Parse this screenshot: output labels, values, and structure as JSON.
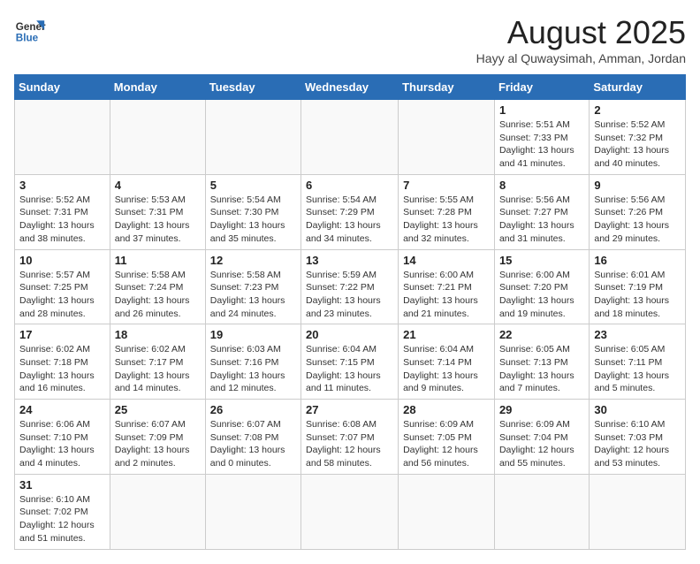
{
  "logo": {
    "line1": "General",
    "line2": "Blue"
  },
  "title": "August 2025",
  "subtitle": "Hayy al Quwaysimah, Amman, Jordan",
  "weekdays": [
    "Sunday",
    "Monday",
    "Tuesday",
    "Wednesday",
    "Thursday",
    "Friday",
    "Saturday"
  ],
  "weeks": [
    [
      {
        "day": "",
        "info": ""
      },
      {
        "day": "",
        "info": ""
      },
      {
        "day": "",
        "info": ""
      },
      {
        "day": "",
        "info": ""
      },
      {
        "day": "",
        "info": ""
      },
      {
        "day": "1",
        "info": "Sunrise: 5:51 AM\nSunset: 7:33 PM\nDaylight: 13 hours\nand 41 minutes."
      },
      {
        "day": "2",
        "info": "Sunrise: 5:52 AM\nSunset: 7:32 PM\nDaylight: 13 hours\nand 40 minutes."
      }
    ],
    [
      {
        "day": "3",
        "info": "Sunrise: 5:52 AM\nSunset: 7:31 PM\nDaylight: 13 hours\nand 38 minutes."
      },
      {
        "day": "4",
        "info": "Sunrise: 5:53 AM\nSunset: 7:31 PM\nDaylight: 13 hours\nand 37 minutes."
      },
      {
        "day": "5",
        "info": "Sunrise: 5:54 AM\nSunset: 7:30 PM\nDaylight: 13 hours\nand 35 minutes."
      },
      {
        "day": "6",
        "info": "Sunrise: 5:54 AM\nSunset: 7:29 PM\nDaylight: 13 hours\nand 34 minutes."
      },
      {
        "day": "7",
        "info": "Sunrise: 5:55 AM\nSunset: 7:28 PM\nDaylight: 13 hours\nand 32 minutes."
      },
      {
        "day": "8",
        "info": "Sunrise: 5:56 AM\nSunset: 7:27 PM\nDaylight: 13 hours\nand 31 minutes."
      },
      {
        "day": "9",
        "info": "Sunrise: 5:56 AM\nSunset: 7:26 PM\nDaylight: 13 hours\nand 29 minutes."
      }
    ],
    [
      {
        "day": "10",
        "info": "Sunrise: 5:57 AM\nSunset: 7:25 PM\nDaylight: 13 hours\nand 28 minutes."
      },
      {
        "day": "11",
        "info": "Sunrise: 5:58 AM\nSunset: 7:24 PM\nDaylight: 13 hours\nand 26 minutes."
      },
      {
        "day": "12",
        "info": "Sunrise: 5:58 AM\nSunset: 7:23 PM\nDaylight: 13 hours\nand 24 minutes."
      },
      {
        "day": "13",
        "info": "Sunrise: 5:59 AM\nSunset: 7:22 PM\nDaylight: 13 hours\nand 23 minutes."
      },
      {
        "day": "14",
        "info": "Sunrise: 6:00 AM\nSunset: 7:21 PM\nDaylight: 13 hours\nand 21 minutes."
      },
      {
        "day": "15",
        "info": "Sunrise: 6:00 AM\nSunset: 7:20 PM\nDaylight: 13 hours\nand 19 minutes."
      },
      {
        "day": "16",
        "info": "Sunrise: 6:01 AM\nSunset: 7:19 PM\nDaylight: 13 hours\nand 18 minutes."
      }
    ],
    [
      {
        "day": "17",
        "info": "Sunrise: 6:02 AM\nSunset: 7:18 PM\nDaylight: 13 hours\nand 16 minutes."
      },
      {
        "day": "18",
        "info": "Sunrise: 6:02 AM\nSunset: 7:17 PM\nDaylight: 13 hours\nand 14 minutes."
      },
      {
        "day": "19",
        "info": "Sunrise: 6:03 AM\nSunset: 7:16 PM\nDaylight: 13 hours\nand 12 minutes."
      },
      {
        "day": "20",
        "info": "Sunrise: 6:04 AM\nSunset: 7:15 PM\nDaylight: 13 hours\nand 11 minutes."
      },
      {
        "day": "21",
        "info": "Sunrise: 6:04 AM\nSunset: 7:14 PM\nDaylight: 13 hours\nand 9 minutes."
      },
      {
        "day": "22",
        "info": "Sunrise: 6:05 AM\nSunset: 7:13 PM\nDaylight: 13 hours\nand 7 minutes."
      },
      {
        "day": "23",
        "info": "Sunrise: 6:05 AM\nSunset: 7:11 PM\nDaylight: 13 hours\nand 5 minutes."
      }
    ],
    [
      {
        "day": "24",
        "info": "Sunrise: 6:06 AM\nSunset: 7:10 PM\nDaylight: 13 hours\nand 4 minutes."
      },
      {
        "day": "25",
        "info": "Sunrise: 6:07 AM\nSunset: 7:09 PM\nDaylight: 13 hours\nand 2 minutes."
      },
      {
        "day": "26",
        "info": "Sunrise: 6:07 AM\nSunset: 7:08 PM\nDaylight: 13 hours\nand 0 minutes."
      },
      {
        "day": "27",
        "info": "Sunrise: 6:08 AM\nSunset: 7:07 PM\nDaylight: 12 hours\nand 58 minutes."
      },
      {
        "day": "28",
        "info": "Sunrise: 6:09 AM\nSunset: 7:05 PM\nDaylight: 12 hours\nand 56 minutes."
      },
      {
        "day": "29",
        "info": "Sunrise: 6:09 AM\nSunset: 7:04 PM\nDaylight: 12 hours\nand 55 minutes."
      },
      {
        "day": "30",
        "info": "Sunrise: 6:10 AM\nSunset: 7:03 PM\nDaylight: 12 hours\nand 53 minutes."
      }
    ],
    [
      {
        "day": "31",
        "info": "Sunrise: 6:10 AM\nSunset: 7:02 PM\nDaylight: 12 hours\nand 51 minutes."
      },
      {
        "day": "",
        "info": ""
      },
      {
        "day": "",
        "info": ""
      },
      {
        "day": "",
        "info": ""
      },
      {
        "day": "",
        "info": ""
      },
      {
        "day": "",
        "info": ""
      },
      {
        "day": "",
        "info": ""
      }
    ]
  ]
}
